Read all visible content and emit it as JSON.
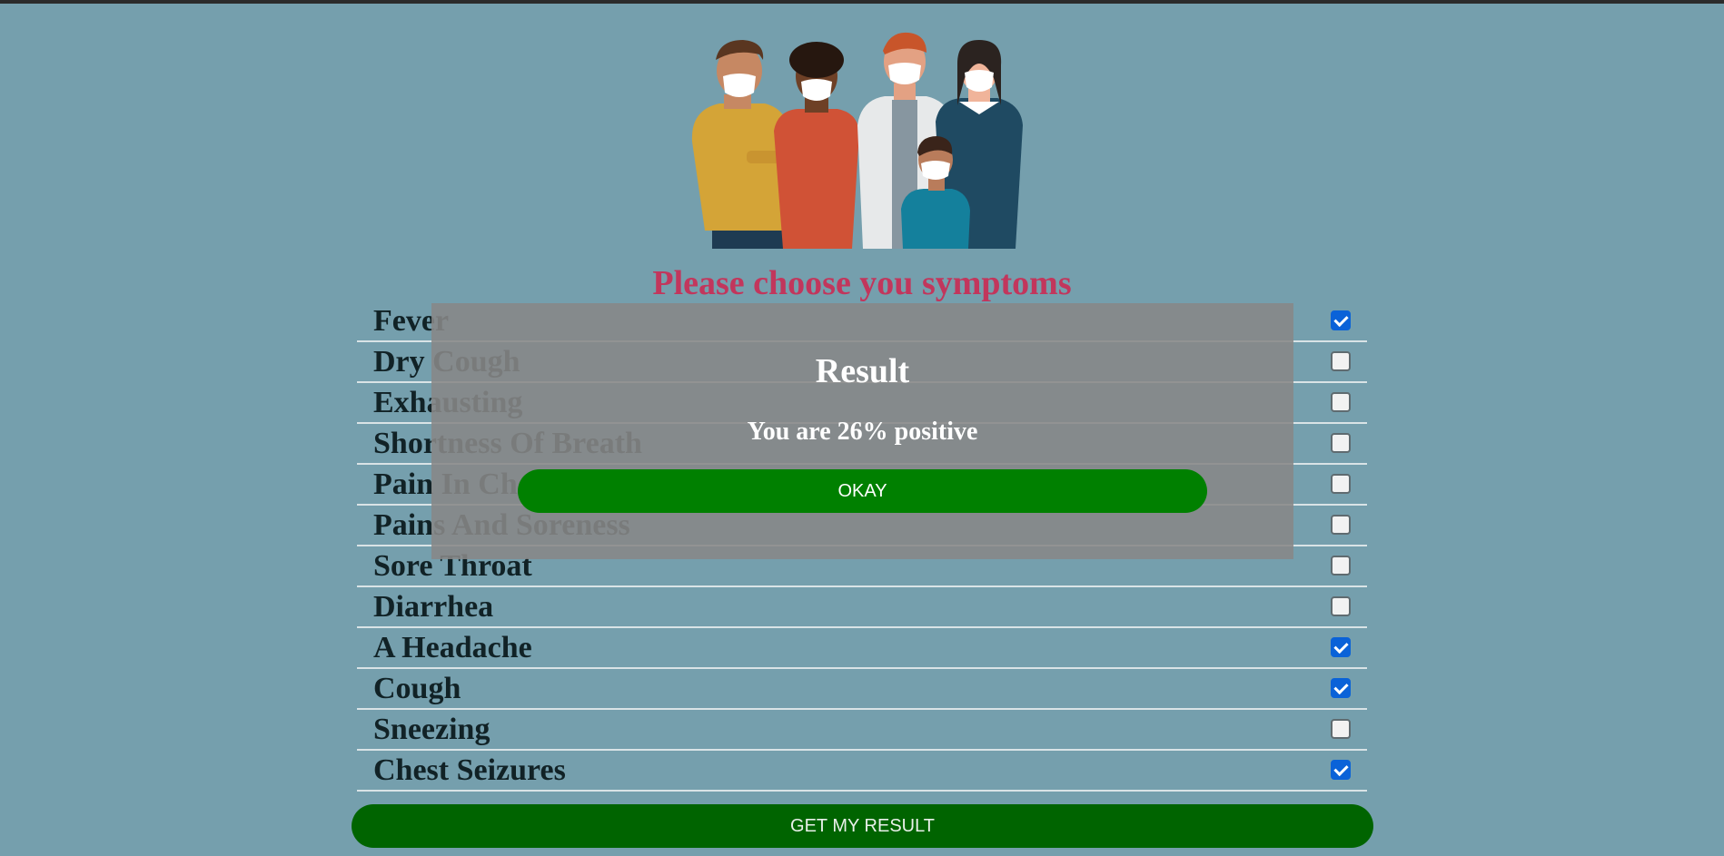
{
  "page": {
    "heading": "Please choose you symptoms",
    "heading_color": "#c2365c",
    "background_color": "#759fad"
  },
  "hero_image": {
    "description_icon": "people-with-masks-illustration-icon"
  },
  "symptoms": [
    {
      "label": "Fever",
      "checked": true
    },
    {
      "label": "Dry Cough",
      "checked": false
    },
    {
      "label": "Exhausting",
      "checked": false
    },
    {
      "label": "Shortness Of Breath",
      "checked": false
    },
    {
      "label": "Pain In Chest",
      "checked": false
    },
    {
      "label": "Pains And Soreness",
      "checked": false
    },
    {
      "label": "Sore Throat",
      "checked": false
    },
    {
      "label": "Diarrhea",
      "checked": false
    },
    {
      "label": "A Headache",
      "checked": true
    },
    {
      "label": "Cough",
      "checked": true
    },
    {
      "label": "Sneezing",
      "checked": false
    },
    {
      "label": "Chest Seizures",
      "checked": true
    }
  ],
  "actions": {
    "get_result_label": "GET MY RESULT",
    "get_result_color": "#006400"
  },
  "modal": {
    "title": "Result",
    "message": "You are 26% positive",
    "okay_label": "OKAY",
    "okay_color": "#008000"
  }
}
